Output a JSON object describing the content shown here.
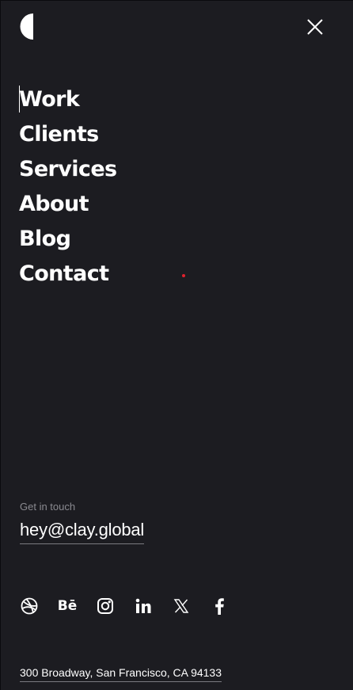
{
  "header": {
    "logo_icon": "half-circle-logo",
    "close_icon": "close-icon"
  },
  "nav": {
    "items": [
      {
        "label": "Work"
      },
      {
        "label": "Clients"
      },
      {
        "label": "Services"
      },
      {
        "label": "About"
      },
      {
        "label": "Blog"
      },
      {
        "label": "Contact"
      }
    ]
  },
  "contact": {
    "label": "Get in touch",
    "email": "hey@clay.global"
  },
  "social": {
    "icons": [
      "dribbble-icon",
      "behance-icon",
      "instagram-icon",
      "linkedin-icon",
      "x-icon",
      "facebook-icon"
    ],
    "behance_text": "Bē"
  },
  "footer": {
    "address": "300 Broadway, San Francisco, CA 94133"
  },
  "colors": {
    "background": "#1c1c21",
    "text": "#ffffff",
    "muted": "#8a8a90",
    "accent_dot": "#e0212d"
  }
}
